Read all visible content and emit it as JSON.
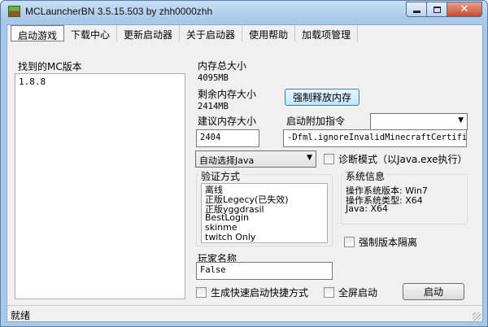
{
  "window": {
    "title": "MCLauncherBN 3.5.15.503  by zhh0000zhh"
  },
  "menu": [
    {
      "label": "启动游戏"
    },
    {
      "label": "下载中心"
    },
    {
      "label": "更新启动器"
    },
    {
      "label": "关于启动器"
    },
    {
      "label": "使用帮助"
    },
    {
      "label": "加载项管理"
    }
  ],
  "versions": {
    "label": "找到的MC版本",
    "items": [
      "1.8.8"
    ]
  },
  "memory": {
    "total_label": "内存总大小",
    "total_value": "4095MB",
    "free_label": "剩余内存大小",
    "free_value": "2414MB",
    "release_button": "强制释放内存",
    "suggest_label": "建议内存大小",
    "suggest_value": "2404",
    "extra_args_label": "启动附加指令",
    "extra_args_value": "-Dfml.ignoreInvalidMinecraftCertificates=true"
  },
  "java": {
    "selected": "自动选择Java"
  },
  "diagnose": {
    "label": "诊断模式（以Java.exe执行）",
    "checked": false
  },
  "auth": {
    "title": "验证方式",
    "options": [
      "离线",
      "正版Legecy(已失效)",
      "正版yggdrasil",
      "BestLogin",
      "skinme",
      "twitch Only"
    ]
  },
  "sysinfo": {
    "title": "系统信息",
    "lines": [
      "操作系统版本: Win7",
      "操作系统类型: X64",
      "Java: X64"
    ]
  },
  "isolate": {
    "label": "强制版本隔离",
    "checked": false
  },
  "player": {
    "label": "玩家名称",
    "value": "False"
  },
  "shortcut": {
    "label": "生成快速启动快捷方式",
    "checked": false
  },
  "fullscreen": {
    "label": "全屏启动",
    "checked": false
  },
  "launch_button": "启动",
  "status": "就绪"
}
